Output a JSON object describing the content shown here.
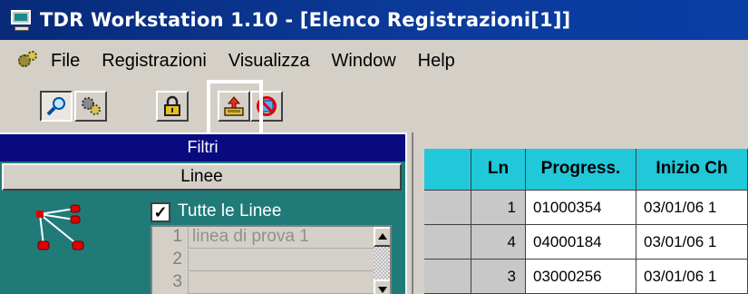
{
  "window": {
    "title": "TDR Workstation 1.10 - [Elenco Registrazioni[1]]",
    "icon": "computer-icon"
  },
  "menu": {
    "icon": "gears-icon",
    "items": [
      "File",
      "Registrazioni",
      "Visualizza",
      "Window",
      "Help"
    ]
  },
  "toolbar": {
    "buttons": [
      {
        "icon": "magnifier-icon",
        "pressed": true
      },
      {
        "icon": "gears-icon",
        "pressed": false
      },
      {
        "icon": "padlock-icon",
        "pressed": false
      },
      {
        "icon": "export-upload-icon",
        "pressed": false,
        "highlighted": true
      },
      {
        "icon": "no-database-icon",
        "pressed": false
      }
    ]
  },
  "filters": {
    "header": "Filtri",
    "group_button": "Linee",
    "all_lines_label": "Tutte le Linee",
    "all_lines_checked": true,
    "lines": [
      {
        "num": "1",
        "name": "linea di prova 1"
      },
      {
        "num": "2",
        "name": ""
      },
      {
        "num": "3",
        "name": ""
      }
    ]
  },
  "recordings": {
    "columns": [
      "",
      "Ln",
      "Progress.",
      "Inizio Ch"
    ],
    "rows": [
      {
        "ln": "1",
        "progress": "01000354",
        "start": "03/01/06  1"
      },
      {
        "ln": "4",
        "progress": "04000184",
        "start": "03/01/06  1"
      },
      {
        "ln": "3",
        "progress": "03000256",
        "start": "03/01/06  1"
      }
    ]
  },
  "colors": {
    "title_bar": "#0a3ea6",
    "panel_teal": "#207a78",
    "filter_header": "#0a0a80",
    "grid_header": "#21c8da"
  }
}
